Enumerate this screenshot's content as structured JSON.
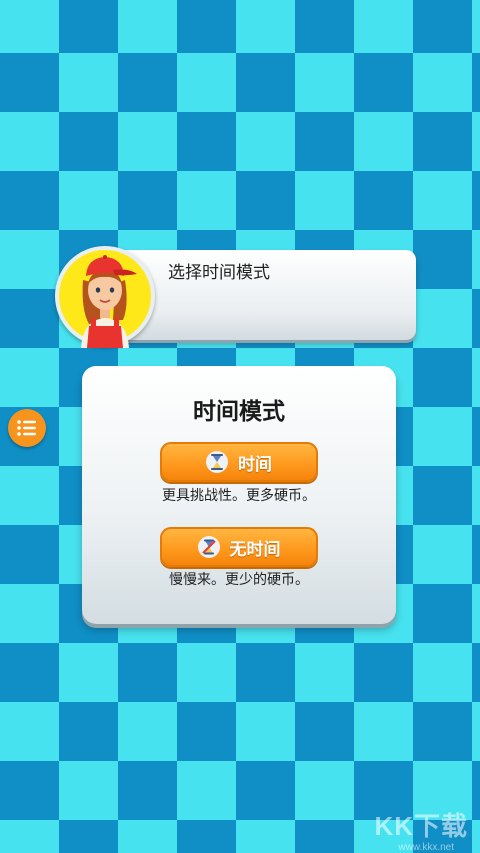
{
  "dialog": {
    "prompt": "选择时间模式"
  },
  "panel": {
    "title": "时间模式",
    "timed": {
      "label": "时间",
      "description": "更具挑战性。更多硬币。",
      "icon": "hourglass-icon"
    },
    "untimed": {
      "label": "无时间",
      "description": "慢慢来。更少的硬币。",
      "icon": "no-timer-icon"
    }
  },
  "menu": {
    "icon": "list-menu-icon"
  },
  "watermark": {
    "text": "KK下载",
    "url": "www.kkx.net"
  },
  "colors": {
    "checker_light": "#47e2ef",
    "checker_dark": "#0f8fc6",
    "button_orange": "#ff9a1f",
    "avatar_bg": "#ffe81a"
  }
}
